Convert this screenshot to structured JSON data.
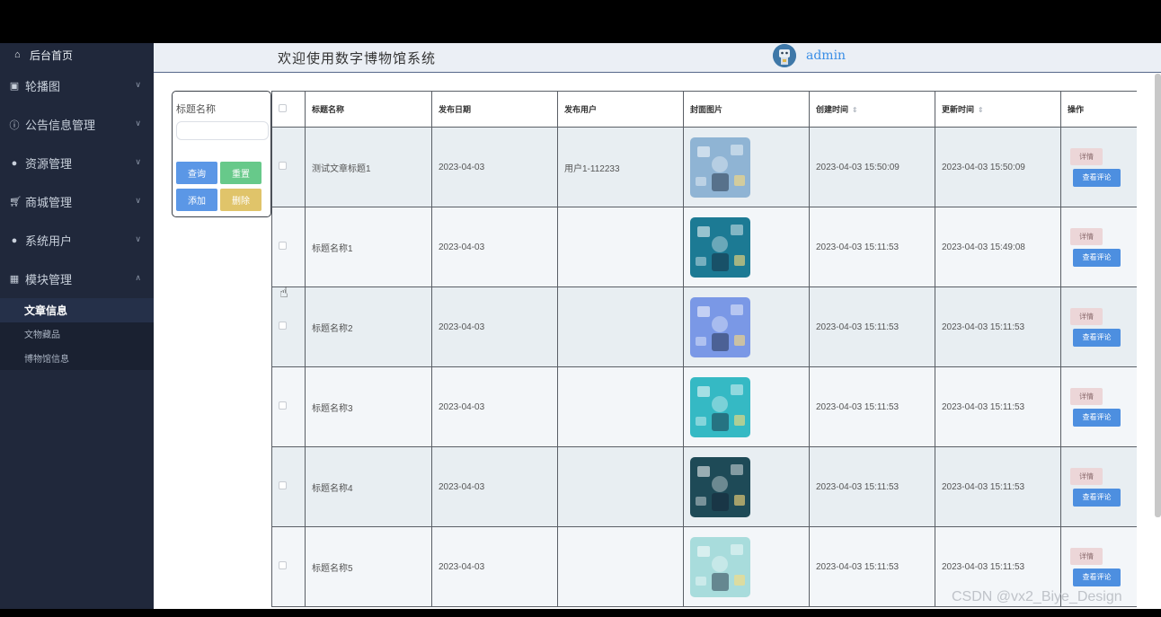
{
  "header": {
    "welcome": "欢迎使用数字博物馆系统",
    "username": "admin"
  },
  "sidebar": {
    "home": "后台首页",
    "items": [
      {
        "label": "轮播图",
        "icon": "image-icon"
      },
      {
        "label": "公告信息管理",
        "icon": "info-icon"
      },
      {
        "label": "资源管理",
        "icon": "pin-icon"
      },
      {
        "label": "商城管理",
        "icon": "cart-icon"
      },
      {
        "label": "系统用户",
        "icon": "user-icon"
      },
      {
        "label": "模块管理",
        "icon": "grid-icon"
      }
    ],
    "submenu": [
      "文章信息",
      "文物藏品",
      "博物馆信息"
    ]
  },
  "search": {
    "label": "标题名称",
    "placeholder": "",
    "query": "查询",
    "reset": "重置",
    "add": "添加",
    "delete": "删除"
  },
  "table": {
    "headers": [
      "标题名称",
      "发布日期",
      "发布用户",
      "封面图片",
      "创建时间",
      "更新时间",
      "操作"
    ],
    "detail_label": "详情",
    "review_label": "查看评论",
    "rows": [
      {
        "title": "测试文章标题1",
        "date": "2023-04-03",
        "user": "用户1-112233",
        "created": "2023-04-03 15:50:09",
        "updated": "2023-04-03 15:50:09",
        "cover_color": "#8fb4d4"
      },
      {
        "title": "标题名称1",
        "date": "2023-04-03",
        "user": "",
        "created": "2023-04-03 15:11:53",
        "updated": "2023-04-03 15:49:08",
        "cover_color": "#1c7a94"
      },
      {
        "title": "标题名称2",
        "date": "2023-04-03",
        "user": "",
        "created": "2023-04-03 15:11:53",
        "updated": "2023-04-03 15:11:53",
        "cover_color": "#7a98e6"
      },
      {
        "title": "标题名称3",
        "date": "2023-04-03",
        "user": "",
        "created": "2023-04-03 15:11:53",
        "updated": "2023-04-03 15:11:53",
        "cover_color": "#35b9c4"
      },
      {
        "title": "标题名称4",
        "date": "2023-04-03",
        "user": "",
        "created": "2023-04-03 15:11:53",
        "updated": "2023-04-03 15:11:53",
        "cover_color": "#1e4a57"
      },
      {
        "title": "标题名称5",
        "date": "2023-04-03",
        "user": "",
        "created": "2023-04-03 15:11:53",
        "updated": "2023-04-03 15:11:53",
        "cover_color": "#a8dcdc"
      }
    ]
  },
  "watermark": "CSDN @vx2_Biye_Design"
}
